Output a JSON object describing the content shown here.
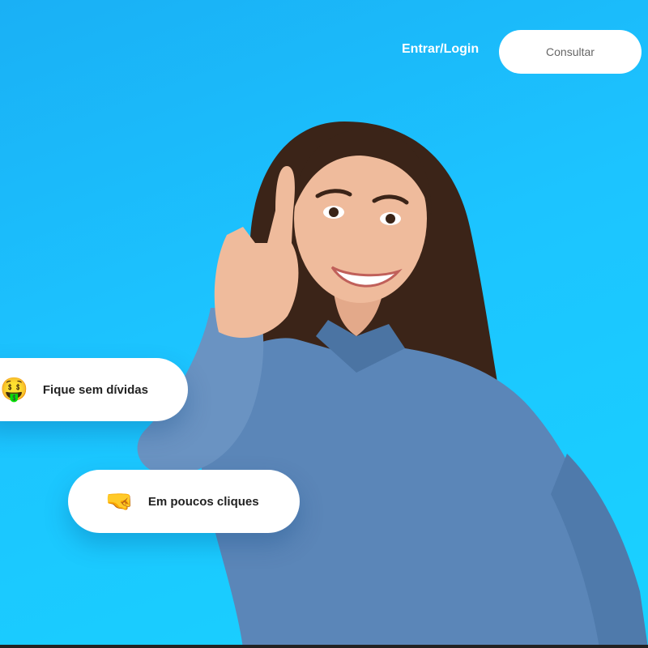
{
  "header": {
    "login_label": "Entrar/Login",
    "consult_label": "Consultar"
  },
  "features": [
    {
      "icon": "money-mouth-face-icon",
      "emoji": "🤑",
      "label": "Fique sem dívidas"
    },
    {
      "icon": "pointing-hand-icon",
      "emoji": "🤜",
      "label": "Em poucos cliques"
    }
  ],
  "colors": {
    "background": "#1cc4ff",
    "pill": "#ffffff",
    "text_dark": "#222222",
    "shirt": "#5b86b8",
    "hair": "#3b2418"
  }
}
